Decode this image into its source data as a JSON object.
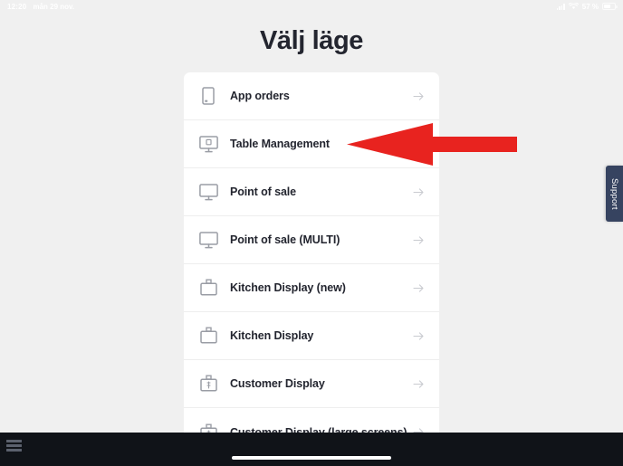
{
  "status_bar": {
    "time": "12:20",
    "date": "mån 29 nov.",
    "battery_percent": "57 %",
    "signal_icon": "cellular-signal-icon",
    "wifi_icon": "wifi-icon",
    "battery_icon": "battery-icon"
  },
  "header": {
    "title": "Välj läge"
  },
  "mode_list": {
    "items": [
      {
        "label": "App orders",
        "icon": "mobile-phone-icon",
        "chevron": "arrow-right-icon"
      },
      {
        "label": "Table Management",
        "icon": "monitor-table-icon",
        "chevron": "arrow-right-icon"
      },
      {
        "label": "Point of sale",
        "icon": "monitor-icon",
        "chevron": "arrow-right-icon"
      },
      {
        "label": "Point of sale (MULTI)",
        "icon": "monitor-icon",
        "chevron": "arrow-right-icon"
      },
      {
        "label": "Kitchen Display (new)",
        "icon": "kitchen-printer-icon",
        "chevron": "arrow-right-icon"
      },
      {
        "label": "Kitchen Display",
        "icon": "kitchen-printer-icon",
        "chevron": "arrow-right-icon"
      },
      {
        "label": "Customer Display",
        "icon": "customer-display-icon",
        "chevron": "arrow-right-icon"
      },
      {
        "label": "Customer Display (large screens)",
        "icon": "customer-display-icon",
        "chevron": "arrow-right-icon"
      }
    ]
  },
  "support_tab": {
    "label": "Support"
  },
  "annotation": {
    "type": "arrow-left",
    "color": "#e8231f",
    "points_to": "Table Management"
  },
  "bottom_bar": {
    "menu_icon": "hamburger-menu-icon",
    "home_indicator": "home-indicator"
  },
  "colors": {
    "background": "#f0f0f0",
    "card": "#ffffff",
    "text": "#23252f",
    "muted_icon": "#9a9da5",
    "chevron": "#c9cbd0",
    "support_tab": "#364360",
    "annotation_red": "#e8231f",
    "bottom_bar": "#101318"
  }
}
